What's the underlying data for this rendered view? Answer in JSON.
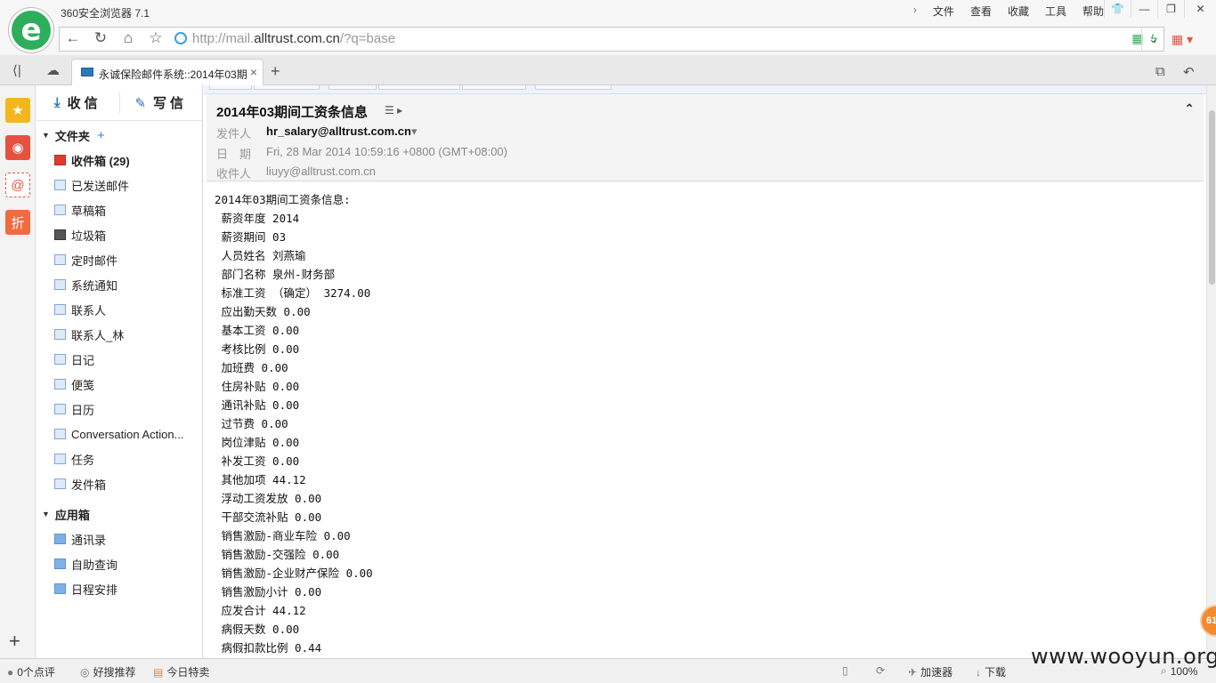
{
  "browser": {
    "app_title": "360安全浏览器 7.1",
    "menu": [
      "文件",
      "查看",
      "收藏",
      "工具",
      "帮助"
    ],
    "url_prefix": "http://mail.",
    "url_domain": "alltrust.com.cn",
    "url_suffix": "/?q=base",
    "tab_title": "永诚保险邮件系统::2014年03期",
    "tab_new": "+",
    "accent": "#2eae5c"
  },
  "mail_nav": {
    "receive_label": "收信",
    "compose_label": "写信",
    "folders_title": "文件夹",
    "folders": [
      {
        "label": "收件箱 (29)",
        "icon": "inbox-icon",
        "bold": true
      },
      {
        "label": "已发送邮件",
        "icon": "folder-icon"
      },
      {
        "label": "草稿箱",
        "icon": "folder-icon"
      },
      {
        "label": "垃圾箱",
        "icon": "trash-icon"
      },
      {
        "label": "定时邮件",
        "icon": "folder-icon"
      },
      {
        "label": "系统通知",
        "icon": "folder-icon"
      },
      {
        "label": "联系人",
        "icon": "folder-icon"
      },
      {
        "label": "联系人_林",
        "icon": "folder-icon"
      },
      {
        "label": "日记",
        "icon": "folder-icon"
      },
      {
        "label": "便笺",
        "icon": "folder-icon"
      },
      {
        "label": "日历",
        "icon": "folder-icon"
      },
      {
        "label": "Conversation Action...",
        "icon": "folder-icon"
      },
      {
        "label": "任务",
        "icon": "folder-icon"
      },
      {
        "label": "发件箱",
        "icon": "folder-icon"
      }
    ],
    "apps_title": "应用箱",
    "apps": [
      "通讯录",
      "自助查询",
      "日程安排"
    ]
  },
  "message": {
    "subject": "2014年03期间工资条信息",
    "from_label": "发件人",
    "from": "hr_salary@alltrust.com.cn",
    "date_label": "日　期",
    "date": "Fri, 28 Mar 2014 10:59:16 +0800 (GMT+08:00)",
    "to_label": "收件人",
    "to": "liuyy@alltrust.com.cn",
    "body_lines": [
      "2014年03期间工资条信息:",
      " 薪资年度 2014",
      " 薪资期间 03",
      " 人员姓名 刘燕瑜",
      " 部门名称 泉州-财务部",
      " 标准工资 （确定） 3274.00",
      " 应出勤天数 0.00",
      " 基本工资 0.00",
      " 考核比例 0.00",
      " 加班费 0.00",
      " 住房补贴 0.00",
      " 通讯补贴 0.00",
      " 过节费 0.00",
      " 岗位津贴 0.00",
      " 补发工资 0.00",
      " 其他加项 44.12",
      " 浮动工资发放 0.00",
      " 干部交流补贴 0.00",
      " 销售激励-商业车险 0.00",
      " 销售激励-交强险 0.00",
      " 销售激励-企业财产保险 0.00",
      " 销售激励小计 0.00",
      " 应发合计 44.12",
      " 病假天数 0.00",
      " 病假扣款比例 0.44"
    ]
  },
  "statusbar": {
    "comments": "0个点评",
    "recommend": "好搜推荐",
    "deals": "今日特卖",
    "accelerator": "加速器",
    "download": "下载",
    "zoom": "100%",
    "watermark": "www.wooyun.org",
    "badge": "61"
  }
}
